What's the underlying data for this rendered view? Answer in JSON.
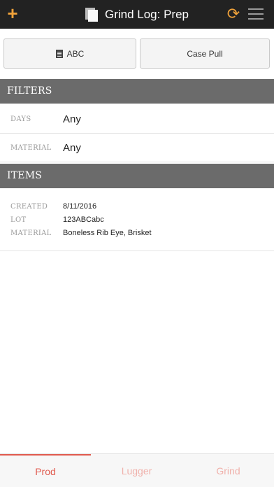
{
  "header": {
    "add_icon": "plus-icon",
    "add_glyph": "+",
    "title": "Grind Log: Prep",
    "doc_icon": "document-icon",
    "refresh_icon": "refresh-icon",
    "refresh_glyph": "⟳",
    "menu_icon": "hamburger-menu-icon",
    "accent_color": "#f0a23a"
  },
  "actions": {
    "abc_label": "ABC",
    "abc_icon": "building-icon",
    "case_pull_label": "Case Pull"
  },
  "filters": {
    "header": "FILTERS",
    "rows": [
      {
        "label": "DAYS",
        "value": "Any"
      },
      {
        "label": "MATERIAL",
        "value": "Any"
      }
    ]
  },
  "items": {
    "header": "ITEMS",
    "list": [
      {
        "created_label": "CREATED",
        "created": "8/11/2016",
        "lot_label": "LOT",
        "lot": "123ABCabc",
        "material_label": "MATERIAL",
        "material": "Boneless Rib Eye, Brisket"
      }
    ]
  },
  "tabs": [
    {
      "label": "Prod",
      "active": true
    },
    {
      "label": "Lugger",
      "active": false
    },
    {
      "label": "Grind",
      "active": false
    }
  ],
  "colors": {
    "topbar": "#222222",
    "section_header": "#6b6b6b",
    "tab_active": "#e05a4e",
    "tab_inactive": "#f0b1ab"
  }
}
